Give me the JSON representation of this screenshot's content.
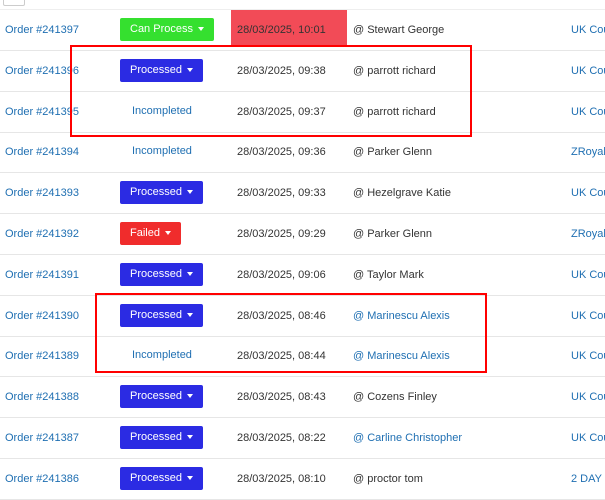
{
  "colors": {
    "link": "#1f6fb2",
    "can_process": "#35e02f",
    "processed": "#2b2be3",
    "failed": "#f02c2c",
    "date_highlight": "#f24b57",
    "annotation_frame": "#ff0000"
  },
  "rows": [
    {
      "order": "Order #241397",
      "status": "Can Process",
      "status_type": "can_process",
      "date": "28/03/2025, 10:01",
      "user": "@ Stewart George",
      "user_link": false,
      "ship": "UK Cou"
    },
    {
      "order": "Order #241396",
      "status": "Processed",
      "status_type": "processed",
      "date": "28/03/2025, 09:38",
      "user": "@ parrott richard",
      "user_link": false,
      "ship": "UK Cou"
    },
    {
      "order": "Order #241395",
      "status": "Incompleted",
      "status_type": "plain",
      "date": "28/03/2025, 09:37",
      "user": "@ parrott richard",
      "user_link": false,
      "ship": "UK Cou"
    },
    {
      "order": "Order #241394",
      "status": "Incompleted",
      "status_type": "plain",
      "date": "28/03/2025, 09:36",
      "user": "@ Parker Glenn",
      "user_link": false,
      "ship": "ZRoyal"
    },
    {
      "order": "Order #241393",
      "status": "Processed",
      "status_type": "processed",
      "date": "28/03/2025, 09:33",
      "user": "@ Hezelgrave Katie",
      "user_link": false,
      "ship": "UK Cou"
    },
    {
      "order": "Order #241392",
      "status": "Failed",
      "status_type": "failed",
      "date": "28/03/2025, 09:29",
      "user": "@ Parker Glenn",
      "user_link": false,
      "ship": "ZRoyal"
    },
    {
      "order": "Order #241391",
      "status": "Processed",
      "status_type": "processed",
      "date": "28/03/2025, 09:06",
      "user": "@ Taylor Mark",
      "user_link": false,
      "ship": "UK Cou"
    },
    {
      "order": "Order #241390",
      "status": "Processed",
      "status_type": "processed",
      "date": "28/03/2025, 08:46",
      "user": "@ Marinescu Alexis",
      "user_link": true,
      "ship": "UK Cou"
    },
    {
      "order": "Order #241389",
      "status": "Incompleted",
      "status_type": "plain",
      "date": "28/03/2025, 08:44",
      "user": "@ Marinescu Alexis",
      "user_link": true,
      "ship": "UK Cou"
    },
    {
      "order": "Order #241388",
      "status": "Processed",
      "status_type": "processed",
      "date": "28/03/2025, 08:43",
      "user": "@ Cozens Finley",
      "user_link": false,
      "ship": "UK Cou"
    },
    {
      "order": "Order #241387",
      "status": "Processed",
      "status_type": "processed",
      "date": "28/03/2025, 08:22",
      "user": "@ Carline Christopher",
      "user_link": true,
      "ship": "UK Cou"
    },
    {
      "order": "Order #241386",
      "status": "Processed",
      "status_type": "processed",
      "date": "28/03/2025, 08:10",
      "user": "@ proctor tom",
      "user_link": false,
      "ship": "2 DAY F"
    }
  ]
}
